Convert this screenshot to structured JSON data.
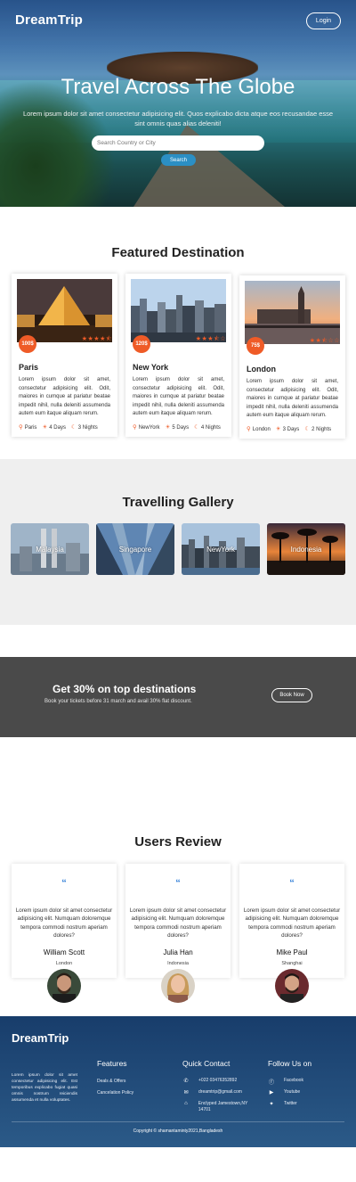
{
  "header": {
    "brand": "DreamTrip",
    "login_label": "Login"
  },
  "hero": {
    "title": "Travel Across The Globe",
    "subtitle": "Lorem ipsum dolor sit amet consectetur adipisicing elit. Quos explicabo dicta atque eos recusandae esse sint omnis quas alias deleniti!",
    "search_placeholder": "Search Country or City",
    "search_button": "Search"
  },
  "featured": {
    "title": "Featured Destination",
    "cards": [
      {
        "price": "100$",
        "rating": 4.5,
        "city": "Paris",
        "desc": "Lorem ipsum dolor sit amet, consectetur adipisicing elit. Odit, maiores in cumque at pariatur beatae impedit nihil, nulla deleniti assumenda autem eum itaque aliquam rerum.",
        "location": "Paris",
        "days": "4 Days",
        "nights": "3 Nights"
      },
      {
        "price": "120$",
        "rating": 3.5,
        "city": "New York",
        "desc": "Lorem ipsum dolor sit amet, consectetur adipisicing elit. Odit, maiores in cumque at pariatur beatae impedit nihil, nulla deleniti assumenda autem eum itaque aliquam rerum.",
        "location": "NewYork",
        "days": "5 Days",
        "nights": "4 Nights"
      },
      {
        "price": "75$",
        "rating": 2.5,
        "city": "London",
        "desc": "Lorem ipsum dolor sit amet, consectetur adipisicing elit. Odit, maiores in cumque at pariatur beatae impedit nihil, nulla deleniti assumenda autem eum itaque aliquam rerum.",
        "location": "London",
        "days": "3 Days",
        "nights": "2 Nights"
      }
    ]
  },
  "gallery": {
    "title": "Travelling Gallery",
    "items": [
      "Malaysia",
      "Singapore",
      "NewYork",
      "Indonesia"
    ]
  },
  "promo": {
    "title": "Get 30% on top destinations",
    "subtitle": "Book your tickets before 31 march and avail 30% flat discount.",
    "button": "Book Now"
  },
  "reviews": {
    "title": "Users Review",
    "items": [
      {
        "text": "Lorem ipsum dolor sit amet consectetur adipisicing elit. Numquam doloremque tempora commodi nostrum aperiam dolores?",
        "name": "William Scott",
        "place": "London"
      },
      {
        "text": "Lorem ipsum dolor sit amet consectetur adipisicing elit. Numquam doloremque tempora commodi nostrum aperiam dolores?",
        "name": "Julia Han",
        "place": "Indonesia"
      },
      {
        "text": "Lorem ipsum dolor sit amet consectetur adipisicing elit. Numquam doloremque tempora commodi nostrum aperiam dolores?",
        "name": "Mike Paul",
        "place": "Shanghai"
      }
    ]
  },
  "footer": {
    "brand": "DreamTrip",
    "about": "Lorem ipsum dolor sit amet consectetur adipisicing elit. Est temporibus explicabo fugiat quasi omnis nostrum reiciendis assumenda et nulla voluptates.",
    "features_title": "Features",
    "features": [
      "Deals & Offers",
      "Cancelation Policy"
    ],
    "contact_title": "Quick Contact",
    "phone": "+022 03476352892",
    "email": "dreamtrip@gmail.com",
    "address": "Enclyped Jamestown,NY 14701",
    "follow_title": "Follow Us on",
    "social": [
      "Facebook",
      "Youtube",
      "Twitter"
    ],
    "copyright": "Copyright © shamantaminty2021,Bangladesh"
  },
  "colors": {
    "accent": "#ef5b27",
    "button_blue": "#2b8fc4",
    "promo_bg": "#4a4a4a",
    "footer_bg": "#183d6b",
    "quote_blue": "#2b7bd6"
  }
}
